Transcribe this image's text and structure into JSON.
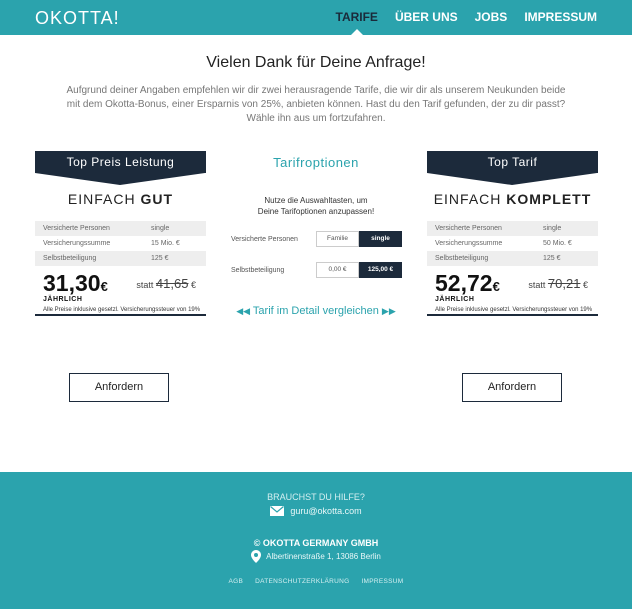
{
  "header": {
    "logo": "OKOTTA!",
    "nav": [
      "TARIFE",
      "ÜBER UNS",
      "JOBS",
      "IMPRESSUM"
    ],
    "active_nav": "TARIFE"
  },
  "main": {
    "title": "Vielen Dank für Deine Anfrage!",
    "intro": "Aufgrund deiner Angaben empfehlen wir dir zwei herausragende Tarife, die wir dir als unserem Neukunden beide mit dem Okotta-Bonus, einer Ersparnis von 25%, anbieten können. Hast du den Tarif gefunden, der zu dir passt? Wähle ihn aus um fortzufahren."
  },
  "left_card": {
    "ribbon": "Top Preis Leistung",
    "plan_prefix": "EINFACH",
    "plan_bold": "GUT",
    "rows": [
      {
        "label": "Versicherte Personen",
        "value": "single"
      },
      {
        "label": "Versicherungssumme",
        "value": "15 Mio. €"
      },
      {
        "label": "Selbstbeteiligung",
        "value": "125 €"
      }
    ],
    "price": "31,30",
    "currency": "€",
    "statt": "statt",
    "old_price": "41,65",
    "old_currency": "€",
    "period": "JÄHRLICH",
    "vat_note": "Alle Preise inklusive gesetzl. Versicherungssteuer von 19%",
    "order_label": "Anfordern"
  },
  "right_card": {
    "ribbon": "Top Tarif",
    "plan_prefix": "EINFACH",
    "plan_bold": "KOMPLETT",
    "rows": [
      {
        "label": "Versicherte Personen",
        "value": "single"
      },
      {
        "label": "Versicherungssumme",
        "value": "50 Mio. €"
      },
      {
        "label": "Selbstbeteiligung",
        "value": "125 €"
      }
    ],
    "price": "52,72",
    "currency": "€",
    "statt": "statt",
    "old_price": "70,21",
    "old_currency": "€",
    "period": "JÄHRLICH",
    "vat_note": "Alle Preise inklusive gesetzl. Versicherungssteuer von 19%",
    "order_label": "Anfordern"
  },
  "options": {
    "title": "Tarifroptionen",
    "hint_line1": "Nutze die Auswahltasten, um",
    "hint_line2": "Deine Tarifoptionen anzupassen!",
    "persons_label": "Versicherte Personen",
    "persons_options": [
      "Familie",
      "single"
    ],
    "persons_selected": "single",
    "deductible_label": "Selbstbeteiligung",
    "deductible_options": [
      "0,00 €",
      "125,00 €"
    ],
    "deductible_selected": "125,00 €",
    "compare_label": "Tarif im Detail vergleichen"
  },
  "footer": {
    "help": "BRAUCHST DU HILFE?",
    "email": "guru@okotta.com",
    "company": "© OKOTTA GERMANY GMBH",
    "address": "Albertinenstraße 1, 13086 Berlin",
    "links": [
      "AGB",
      "DATENSCHUTZERKLÄRUNG",
      "IMPRESSUM"
    ]
  },
  "colors": {
    "brand": "#2ba3ad",
    "dark": "#1c2a3b"
  }
}
